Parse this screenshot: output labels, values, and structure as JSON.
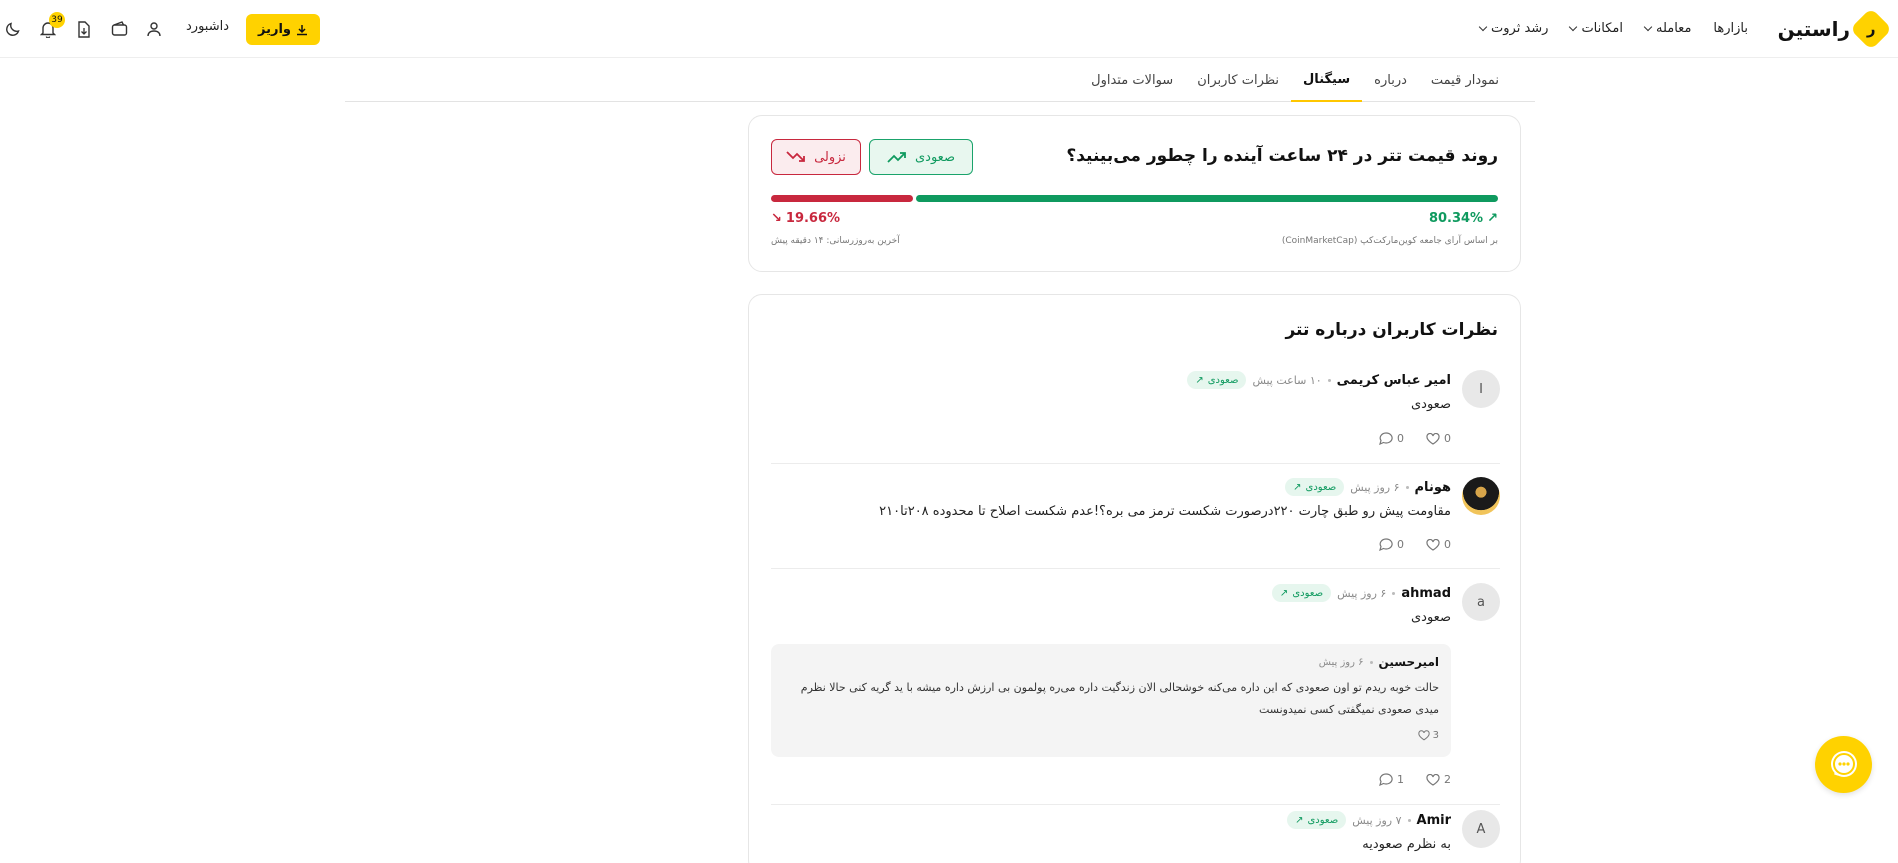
{
  "brand": {
    "logo_text": "راستین",
    "logo_mark": "ر"
  },
  "nav": {
    "items": [
      {
        "label": "بازارها",
        "dropdown": false
      },
      {
        "label": "معامله",
        "dropdown": true
      },
      {
        "label": "امکانات",
        "dropdown": true
      },
      {
        "label": "رشد ثروت",
        "dropdown": true
      }
    ]
  },
  "header_tools": {
    "deposit_label": "واریز",
    "dashboard_label": "داشبورد",
    "notification_count": "39",
    "icons": [
      "user-icon",
      "wallet-icon",
      "export-icon",
      "bell-icon",
      "moon-icon"
    ]
  },
  "tabs": [
    {
      "label": "نمودار قیمت",
      "active": false
    },
    {
      "label": "درباره",
      "active": false
    },
    {
      "label": "سیگنال",
      "active": true
    },
    {
      "label": "نظرات کاربران",
      "active": false
    },
    {
      "label": "سوالات متداول",
      "active": false
    }
  ],
  "signal": {
    "question": "روند قیمت تتر در ۲۴ ساعت آینده را چطور می‌بینید؟",
    "up_label": "صعودی",
    "down_label": "نزولی",
    "up_percent_value": 80.34,
    "down_percent_value": 19.66,
    "up_percent_text": "80.34%",
    "down_percent_text": "19.66%",
    "source_note": "بر اساس آرای جامعه کوین‌مارکت‌کپ (CoinMarketCap)",
    "update_note": "آخرین به‌روزرسانی: ۱۴ دقیقه پیش",
    "colors": {
      "up": "#0f9a5f",
      "down": "#c8283e"
    }
  },
  "comments": {
    "title": "نظرات کاربران درباره تتر",
    "items": [
      {
        "avatar_letter": "I",
        "name": "امیر عباس کریمی",
        "time": "۱۰ ساعت پیش",
        "badge": "صعودی",
        "text": "صعودی",
        "likes": "0",
        "replies": "0"
      },
      {
        "avatar_letter": "",
        "name": "هونام",
        "time": "۶ روز پیش",
        "badge": "صعودی",
        "text": "مقاومت پیش رو طبق چارت ۲۲۰درصورت شکست ترمز می بره؟!عدم شکست اصلاح تا محدوده ۲۰۸تا۲۱۰",
        "likes": "0",
        "replies": "0"
      },
      {
        "avatar_letter": "a",
        "name": "ahmad",
        "time": "۶ روز پیش",
        "badge": "صعودی",
        "text": "صعودی",
        "likes": "2",
        "replies": "1",
        "reply": {
          "name": "امیرحسین",
          "time": "۶ روز پیش",
          "text": "حالت خوبه ریدم تو اون صعودی که این داره می‌کنه خوشحالی الان زندگیت داره می‌ره پولمون بی ارزش داره میشه با ید گریه کنی حالا نظرم میدی صعودی نمیگفتی کسی نمیدونست",
          "likes": "3"
        }
      },
      {
        "avatar_letter": "A",
        "name": "Amir",
        "time": "۷ روز پیش",
        "badge": "صعودی",
        "text": "به نظرم صعودیه",
        "likes": "",
        "replies": ""
      }
    ]
  },
  "support": {
    "icon": "chat-support-icon"
  }
}
